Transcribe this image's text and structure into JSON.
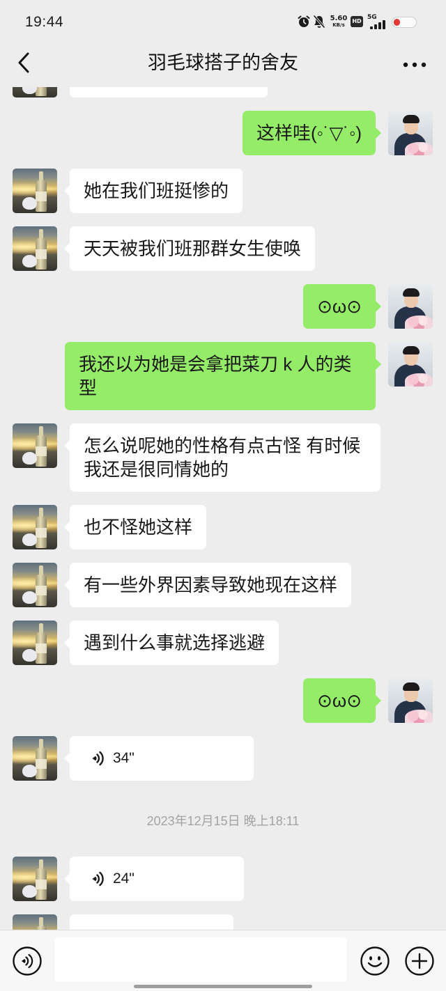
{
  "status_bar": {
    "time": "19:44",
    "net_speed": "5.60",
    "net_speed_unit": "KB/s",
    "hd_badge": "HD",
    "network_type": "5G",
    "icons": {
      "alarm": "alarm-icon",
      "mute": "mute-icon",
      "signal": "signal-icon",
      "battery": "battery-icon"
    }
  },
  "header": {
    "title": "羽毛球搭子的舍友",
    "icons": {
      "back": "chevron-left-icon",
      "more": "more-icon"
    }
  },
  "messages": [
    {
      "text": "这样哇(◦˙▽˙◦)"
    },
    {
      "text": "她在我们班挺惨的"
    },
    {
      "text": "天天被我们班那群女生使唤"
    },
    {
      "text": "⊙ω⊙"
    },
    {
      "text": "我还以为她是会拿把菜刀 k 人的类型"
    },
    {
      "text": "怎么说呢她的性格有点古怪 有时候我还是很同情她的"
    },
    {
      "text": "也不怪她这样"
    },
    {
      "text": "有一些外界因素导致她现在这样"
    },
    {
      "text": "遇到什么事就选择逃避"
    },
    {
      "text": "⊙ω⊙"
    },
    {
      "voice_duration": "34\"",
      "icon": "voice-message-icon"
    },
    {
      "voice_duration": "24\"",
      "icon": "voice-message-icon"
    }
  ],
  "time_divider": "2023年12月15日 晚上18:11",
  "input_bar": {
    "icons": {
      "voice": "voice-input-icon",
      "emoji": "emoji-icon",
      "more": "plus-icon"
    }
  },
  "colors": {
    "background": "#ededed",
    "sent_bubble": "#95ec69",
    "received_bubble": "#ffffff",
    "time_divider_text": "#a3a3a3"
  }
}
